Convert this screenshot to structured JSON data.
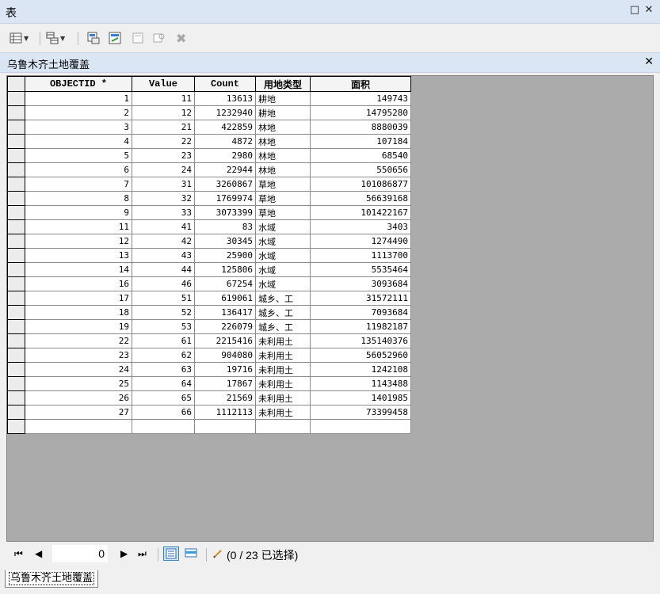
{
  "window": {
    "title": "表",
    "maximize_glyph": "□",
    "close_glyph": "✕"
  },
  "toolbar": {
    "icons": [
      "table-options-icon",
      "related-tables-icon",
      "select-by-attributes-icon",
      "switch-selection-icon",
      "clear-selection-icon",
      "zoom-to-selected-icon",
      "delete-selected-icon"
    ],
    "delete_glyph": "✖"
  },
  "tab": {
    "title": "乌鲁木齐土地覆盖",
    "close_glyph": "✕"
  },
  "grid": {
    "columns": [
      "OBJECTID *",
      "Value",
      "Count",
      "用地类型",
      "面积"
    ],
    "rows": [
      [
        "1",
        "11",
        "13613",
        "耕地",
        "149743"
      ],
      [
        "2",
        "12",
        "1232940",
        "耕地",
        "14795280"
      ],
      [
        "3",
        "21",
        "422859",
        "林地",
        "8880039"
      ],
      [
        "4",
        "22",
        "4872",
        "林地",
        "107184"
      ],
      [
        "5",
        "23",
        "2980",
        "林地",
        "68540"
      ],
      [
        "6",
        "24",
        "22944",
        "林地",
        "550656"
      ],
      [
        "7",
        "31",
        "3260867",
        "草地",
        "101086877"
      ],
      [
        "8",
        "32",
        "1769974",
        "草地",
        "56639168"
      ],
      [
        "9",
        "33",
        "3073399",
        "草地",
        "101422167"
      ],
      [
        "11",
        "41",
        "83",
        "水域",
        "3403"
      ],
      [
        "12",
        "42",
        "30345",
        "水域",
        "1274490"
      ],
      [
        "13",
        "43",
        "25900",
        "水域",
        "1113700"
      ],
      [
        "14",
        "44",
        "125806",
        "水域",
        "5535464"
      ],
      [
        "16",
        "46",
        "67254",
        "水域",
        "3093684"
      ],
      [
        "17",
        "51",
        "619061",
        "城乡、工",
        "31572111"
      ],
      [
        "18",
        "52",
        "136417",
        "城乡、工",
        "7093684"
      ],
      [
        "19",
        "53",
        "226079",
        "城乡、工",
        "11982187"
      ],
      [
        "22",
        "61",
        "2215416",
        "未利用土",
        "135140376"
      ],
      [
        "23",
        "62",
        "904080",
        "未利用土",
        "56052960"
      ],
      [
        "24",
        "63",
        "19716",
        "未利用土",
        "1242108"
      ],
      [
        "25",
        "64",
        "17867",
        "未利用土",
        "1143488"
      ],
      [
        "26",
        "65",
        "21569",
        "未利用土",
        "1401985"
      ],
      [
        "27",
        "66",
        "1112113",
        "未利用土",
        "73399458"
      ]
    ]
  },
  "navbar": {
    "first": "⏮",
    "prev": "◀",
    "record_value": "0",
    "next": "▶",
    "last": "⏭",
    "selection_text": "(0 / 23 已选择)"
  },
  "bottom_tab": {
    "label": "乌鲁木齐土地覆盖"
  }
}
